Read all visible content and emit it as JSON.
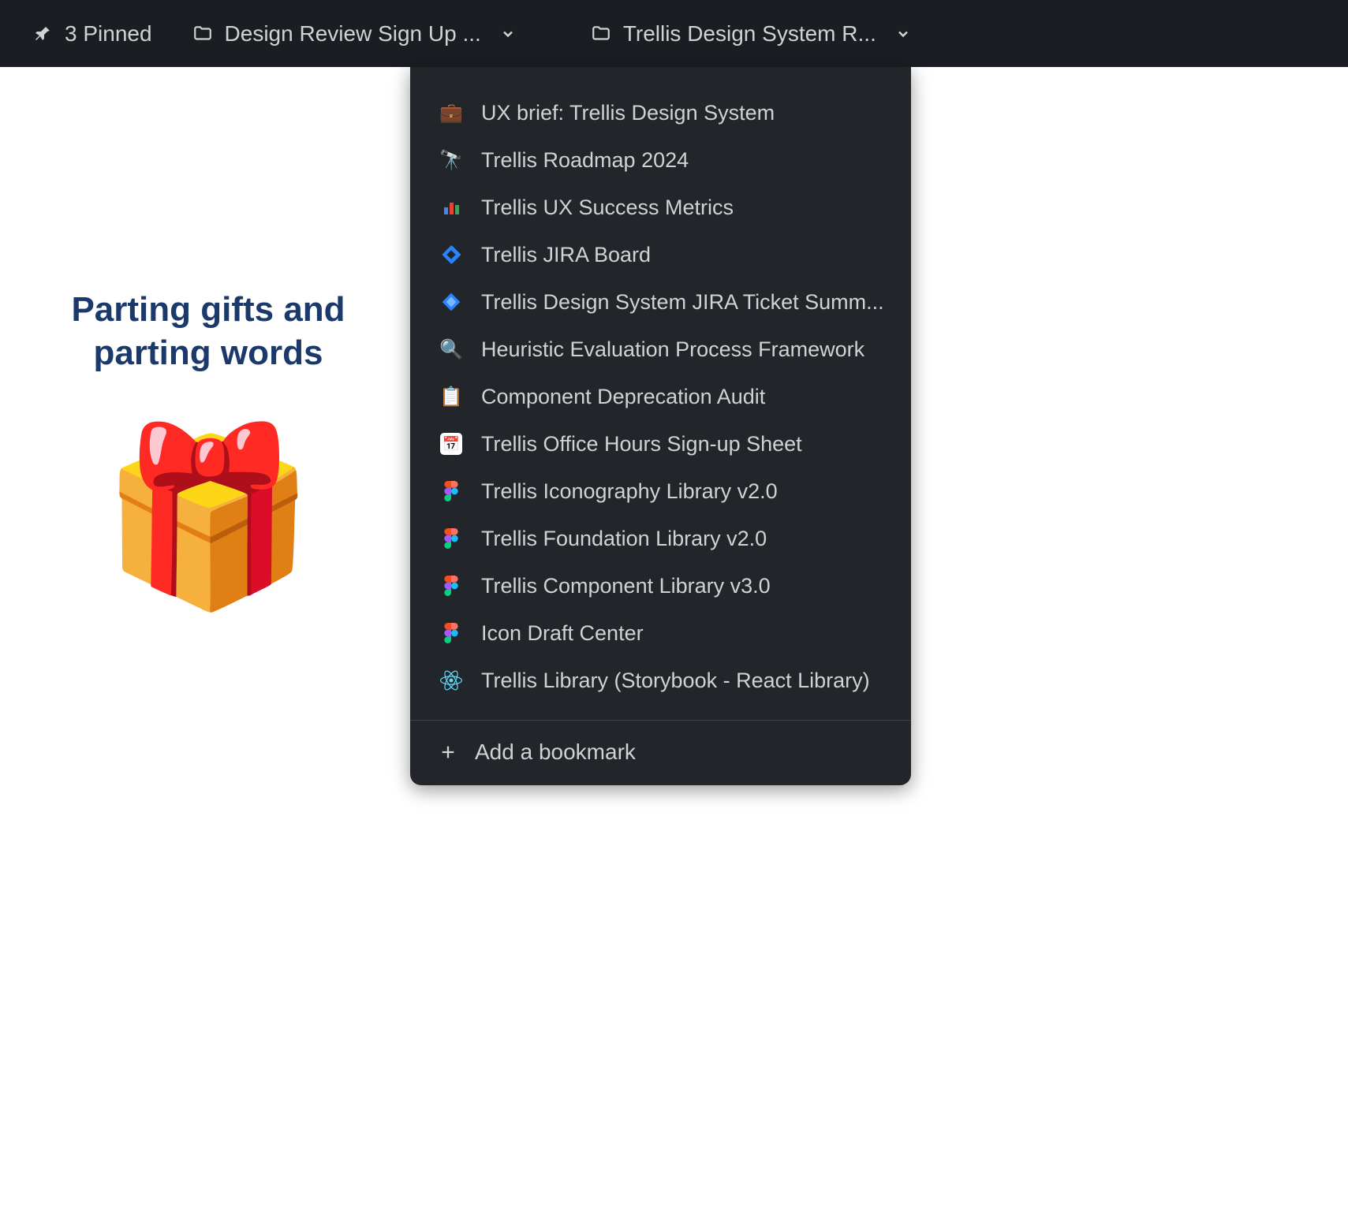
{
  "topbar": {
    "pinned": {
      "label": "3 Pinned"
    },
    "folders": [
      {
        "label": "Design Review Sign Up ..."
      },
      {
        "label": "Trellis Design System R..."
      }
    ]
  },
  "slide": {
    "title_line1": "Parting gifts and",
    "title_line2": "parting words",
    "emoji": "🎁"
  },
  "dropdown": {
    "items": [
      {
        "icon": "briefcase-icon",
        "emoji": "💼",
        "label": "UX brief: Trellis Design System"
      },
      {
        "icon": "telescope-icon",
        "emoji": "🔭",
        "label": "Trellis Roadmap 2024"
      },
      {
        "icon": "bar-chart-icon",
        "emoji": "📊",
        "label": "Trellis UX Success Metrics"
      },
      {
        "icon": "jira-icon",
        "emoji": "jira",
        "label": "Trellis JIRA Board"
      },
      {
        "icon": "jira-software-icon",
        "emoji": "jira-diamond",
        "label": "Trellis Design System JIRA Ticket Summ..."
      },
      {
        "icon": "magnifier-icon",
        "emoji": "🔍",
        "label": "Heuristic Evaluation Process Framework"
      },
      {
        "icon": "clipboard-icon",
        "emoji": "📋",
        "label": "Component Deprecation Audit"
      },
      {
        "icon": "calendar-icon",
        "emoji": "cal",
        "label": "Trellis Office Hours Sign-up Sheet"
      },
      {
        "icon": "figma-icon",
        "emoji": "figma",
        "label": "Trellis Iconography Library v2.0"
      },
      {
        "icon": "figma-icon",
        "emoji": "figma",
        "label": "Trellis Foundation Library v2.0"
      },
      {
        "icon": "figma-icon",
        "emoji": "figma",
        "label": "Trellis Component Library v3.0"
      },
      {
        "icon": "figma-icon",
        "emoji": "figma",
        "label": "Icon Draft Center"
      },
      {
        "icon": "react-icon",
        "emoji": "react",
        "label": "Trellis Library (Storybook - React Library)"
      }
    ],
    "add_label": "Add a bookmark"
  }
}
